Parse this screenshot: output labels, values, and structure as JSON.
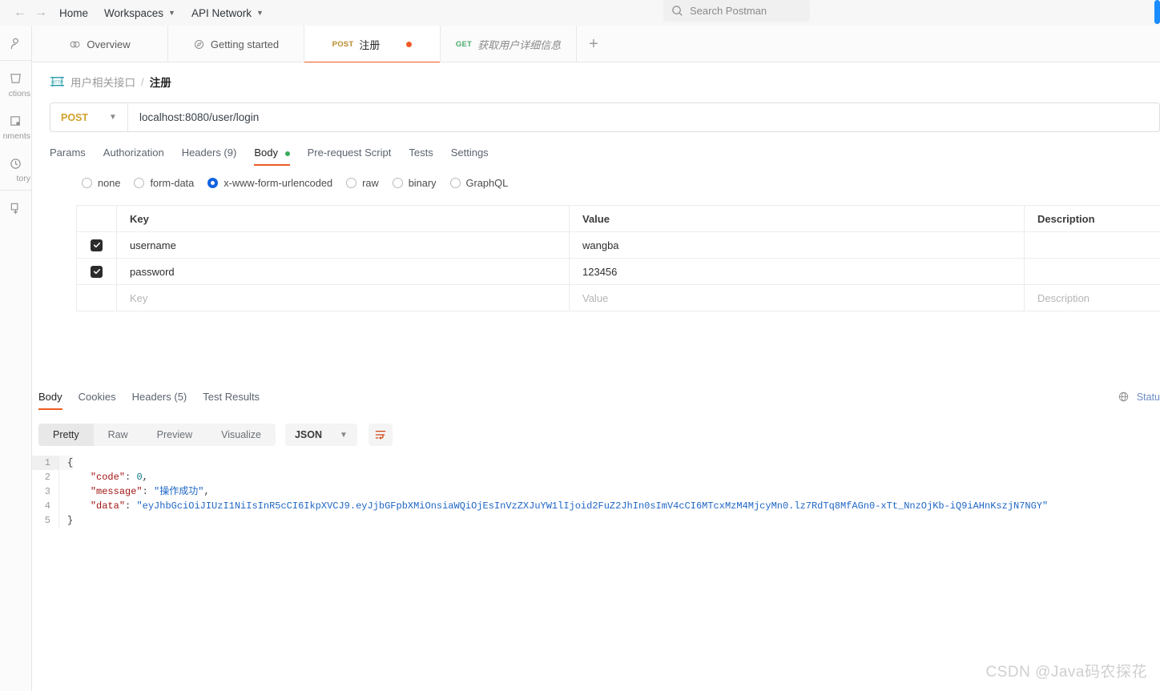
{
  "topbar": {
    "back_icon": "arrow-left-icon",
    "forward_icon": "arrow-right-icon",
    "home": "Home",
    "workspaces": "Workspaces",
    "api_network": "API Network",
    "search_placeholder": "Search Postman"
  },
  "rail": {
    "items": [
      {
        "icon": "user-icon",
        "label": ""
      },
      {
        "icon": "collections-icon",
        "label": "ctions"
      },
      {
        "icon": "environments-icon",
        "label": "nments"
      },
      {
        "icon": "history-icon",
        "label": "tory"
      },
      {
        "icon": "new-icon",
        "label": ""
      }
    ]
  },
  "tabs": [
    {
      "icon": "overview-icon",
      "label": "Overview",
      "method": "",
      "active": false,
      "unsaved": false,
      "italic": false
    },
    {
      "icon": "getting-started-icon",
      "label": "Getting started",
      "method": "",
      "active": false,
      "unsaved": false,
      "italic": false
    },
    {
      "icon": "",
      "label": "注册",
      "method": "POST",
      "method_class": "post",
      "active": true,
      "unsaved": true,
      "italic": false
    },
    {
      "icon": "",
      "label": "获取用户详细信息",
      "method": "GET",
      "method_class": "get",
      "active": false,
      "unsaved": false,
      "italic": true
    }
  ],
  "tab_add_label": "+",
  "breadcrumb": {
    "protocol_icon": "http-icon",
    "protocol_label": "HTTP",
    "folder": "用户相关接口",
    "separator": "/",
    "name": "注册"
  },
  "request": {
    "method": "POST",
    "url": "localhost:8080/user/login",
    "tabs": [
      {
        "label": "Params",
        "active": false,
        "dot": false
      },
      {
        "label": "Authorization",
        "active": false,
        "dot": false
      },
      {
        "label": "Headers (9)",
        "active": false,
        "dot": false
      },
      {
        "label": "Body",
        "active": true,
        "dot": true
      },
      {
        "label": "Pre-request Script",
        "active": false,
        "dot": false
      },
      {
        "label": "Tests",
        "active": false,
        "dot": false
      },
      {
        "label": "Settings",
        "active": false,
        "dot": false
      }
    ],
    "body_types": [
      {
        "label": "none",
        "selected": false
      },
      {
        "label": "form-data",
        "selected": false
      },
      {
        "label": "x-www-form-urlencoded",
        "selected": true
      },
      {
        "label": "raw",
        "selected": false
      },
      {
        "label": "binary",
        "selected": false
      },
      {
        "label": "GraphQL",
        "selected": false
      }
    ],
    "table": {
      "headers": {
        "key": "Key",
        "value": "Value",
        "description": "Description"
      },
      "rows": [
        {
          "checked": true,
          "key": "username",
          "value": "wangba",
          "description": ""
        },
        {
          "checked": true,
          "key": "password",
          "value": "123456",
          "description": ""
        }
      ],
      "placeholder_row": {
        "key": "Key",
        "value": "Value",
        "description": "Description"
      }
    }
  },
  "response": {
    "tabs": [
      {
        "label": "Body",
        "active": true
      },
      {
        "label": "Cookies",
        "active": false
      },
      {
        "label": "Headers (5)",
        "active": false
      },
      {
        "label": "Test Results",
        "active": false
      }
    ],
    "status_icon": "globe-icon",
    "status_label": "Statu",
    "view_modes": [
      {
        "label": "Pretty",
        "active": true
      },
      {
        "label": "Raw",
        "active": false
      },
      {
        "label": "Preview",
        "active": false
      },
      {
        "label": "Visualize",
        "active": false
      }
    ],
    "format": "JSON",
    "wrap_icon": "word-wrap-icon",
    "body_lines": [
      {
        "no": "1",
        "parts": [
          {
            "t": "{",
            "c": "p"
          }
        ]
      },
      {
        "no": "2",
        "parts": [
          {
            "t": "    ",
            "c": "p"
          },
          {
            "t": "\"code\"",
            "c": "k"
          },
          {
            "t": ": ",
            "c": "p"
          },
          {
            "t": "0",
            "c": "n"
          },
          {
            "t": ",",
            "c": "p"
          }
        ]
      },
      {
        "no": "3",
        "parts": [
          {
            "t": "    ",
            "c": "p"
          },
          {
            "t": "\"message\"",
            "c": "k"
          },
          {
            "t": ": ",
            "c": "p"
          },
          {
            "t": "\"操作成功\"",
            "c": "s"
          },
          {
            "t": ",",
            "c": "p"
          }
        ]
      },
      {
        "no": "4",
        "parts": [
          {
            "t": "    ",
            "c": "p"
          },
          {
            "t": "\"data\"",
            "c": "k"
          },
          {
            "t": ": ",
            "c": "p"
          },
          {
            "t": "\"eyJhbGciOiJIUzI1NiIsInR5cCI6IkpXVCJ9.eyJjbGFpbXMiOnsiaWQiOjEsInVzZXJuYW1lIjoid2FuZ2JhIn0sImV4cCI6MTcxMzM4MjcyMn0.lz7RdTq8MfAGn0-xTt_NnzOjKb-iQ9iAHnKszjN7NGY\"",
            "c": "s"
          }
        ]
      },
      {
        "no": "5",
        "parts": [
          {
            "t": "}",
            "c": "p"
          }
        ]
      }
    ]
  },
  "watermark": "CSDN @Java码农探花",
  "colors": {
    "accent_orange": "#ef5b25",
    "post_amber": "#d1a129",
    "get_green": "#4aa96c",
    "radio_blue": "#1363df",
    "json_key": "#a31515",
    "json_string": "#1f66c4",
    "json_number": "#0f7b8a",
    "http_icon_teal": "#1f9aa6"
  }
}
